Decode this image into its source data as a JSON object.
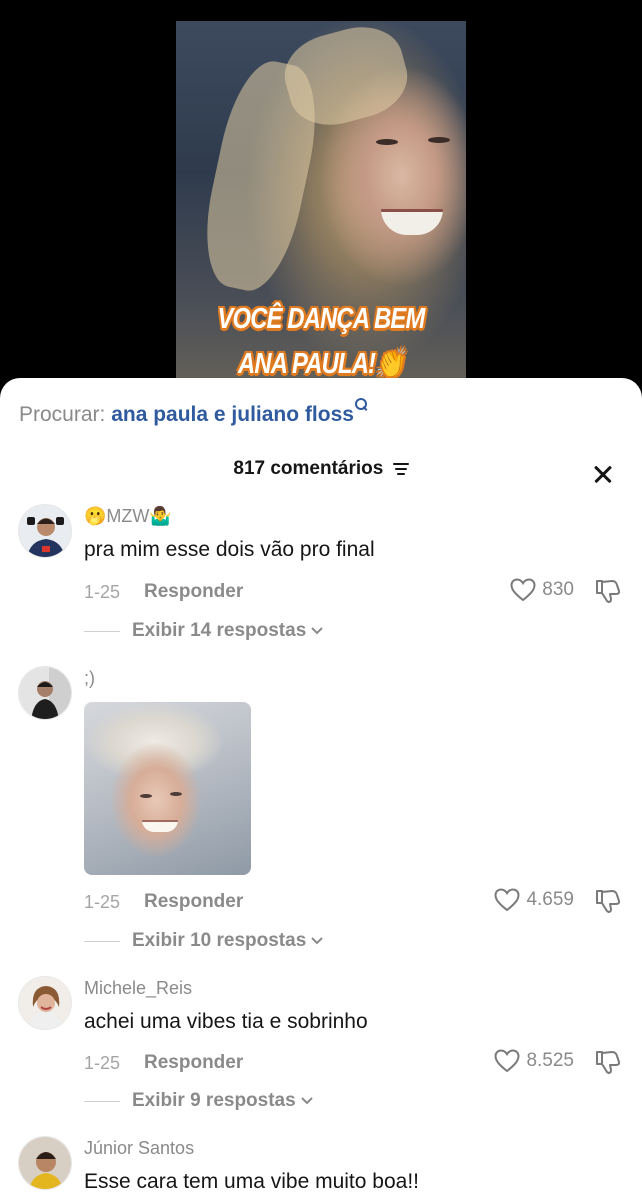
{
  "video": {
    "caption_line1": "VOCÊ DANÇA BEM",
    "caption_line2": "ANA PAULA!👏"
  },
  "search": {
    "label": "Procurar:",
    "query": "ana paula e juliano floss"
  },
  "comments_panel": {
    "count_label": "817 comentários"
  },
  "comments": [
    {
      "username": "🫢MZW🤷‍♂️",
      "text": "pra mim esse dois vão pro final",
      "date": "1-25",
      "reply_label": "Responder",
      "likes": "830",
      "view_replies": "Exibir 14 respostas"
    },
    {
      "username": ";)",
      "text": "",
      "date": "1-25",
      "reply_label": "Responder",
      "likes": "4.659",
      "view_replies": "Exibir 10 respostas"
    },
    {
      "username": "Michele_Reis",
      "text": "achei uma vibes tia e sobrinho",
      "date": "1-25",
      "reply_label": "Responder",
      "likes": "8.525",
      "view_replies": "Exibir 9 respostas"
    },
    {
      "username": "Júnior Santos",
      "text": "Esse cara tem uma vibe muito boa!!"
    }
  ],
  "colors": {
    "accent_link": "#2f5b9e",
    "muted_text": "#8a8a8a",
    "caption_stroke": "#e07a1f"
  },
  "icons": [
    "search-icon",
    "sort-icon",
    "close-icon",
    "heart-icon",
    "dislike-icon",
    "chevron-down-icon"
  ]
}
